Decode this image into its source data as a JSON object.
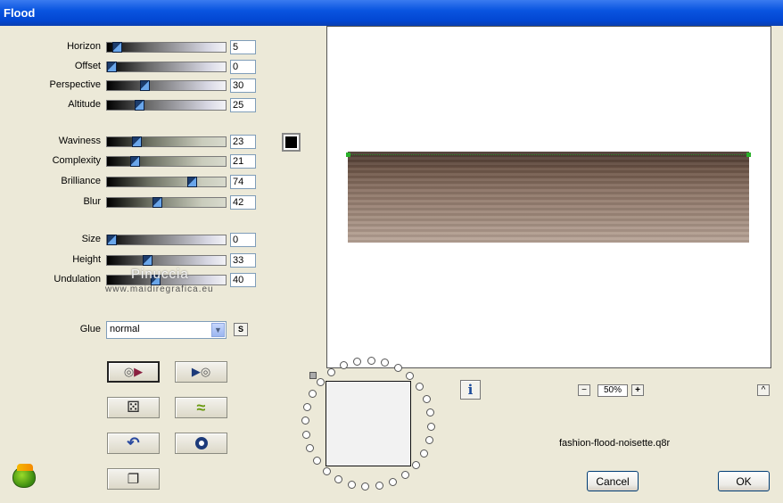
{
  "window": {
    "title": "Flood"
  },
  "sliders": [
    {
      "label": "Horizon",
      "value": "5",
      "level": 0.05,
      "style": "gray"
    },
    {
      "label": "Offset",
      "value": "0",
      "level": 0.0,
      "style": "gray"
    },
    {
      "label": "Perspective",
      "value": "30",
      "level": 0.3,
      "style": "gray"
    },
    {
      "label": "Altitude",
      "value": "25",
      "level": 0.25,
      "style": "gray"
    },
    {
      "label": "Waviness",
      "value": "23",
      "level": 0.23,
      "style": "sage"
    },
    {
      "label": "Complexity",
      "value": "21",
      "level": 0.21,
      "style": "sage"
    },
    {
      "label": "Brilliance",
      "value": "74",
      "level": 0.74,
      "style": "sage"
    },
    {
      "label": "Blur",
      "value": "42",
      "level": 0.42,
      "style": "sage"
    },
    {
      "label": "Size",
      "value": "0",
      "level": 0.0,
      "style": "gray"
    },
    {
      "label": "Height",
      "value": "33",
      "level": 0.33,
      "style": "gray"
    },
    {
      "label": "Undulation",
      "value": "40",
      "level": 0.4,
      "style": "gray"
    }
  ],
  "color_swatch": "#000000",
  "watermark": {
    "name": "Pinuccia",
    "url": "www.maidiregrafica.eu"
  },
  "glue": {
    "label": "Glue",
    "value": "normal",
    "s_button": "S"
  },
  "zoom": {
    "minus": "−",
    "value": "50%",
    "plus": "+",
    "up": "^"
  },
  "info_icon": "i",
  "preset_file": "fashion-flood-noisette.q8r",
  "buttons": {
    "cancel": "Cancel",
    "ok": "OK"
  },
  "colors": {
    "titlebar": "#0a55e0",
    "dialog_bg": "#ece9d8"
  }
}
